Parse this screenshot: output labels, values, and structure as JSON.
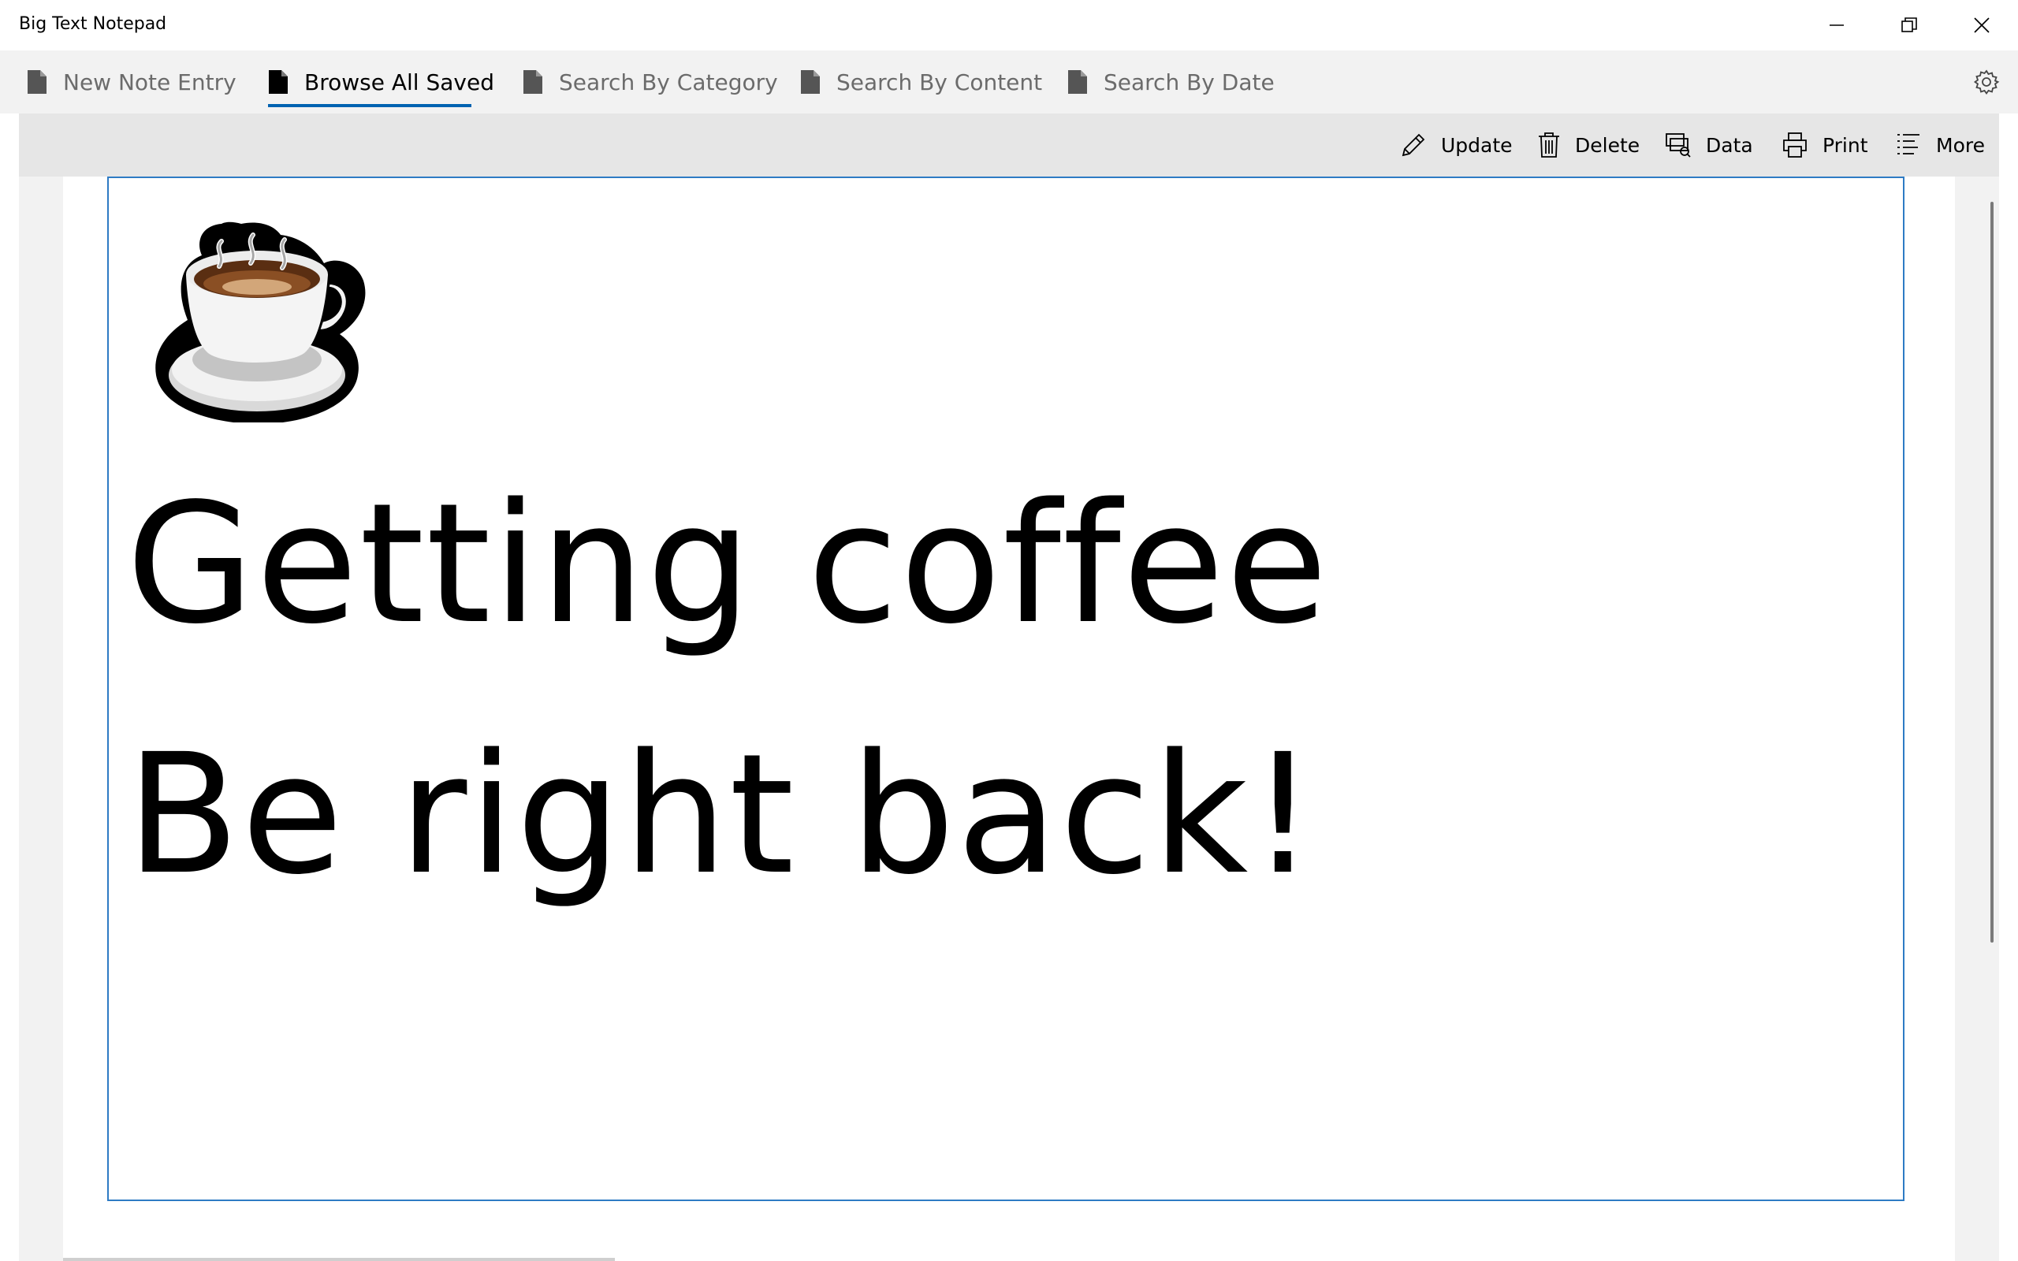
{
  "window": {
    "title": "Big Text Notepad",
    "controls": [
      "minimize",
      "restore",
      "close"
    ]
  },
  "tabs": [
    {
      "label": "New Note Entry",
      "icon": "document-icon",
      "active": false
    },
    {
      "label": "Browse All Saved",
      "icon": "document-icon",
      "active": true
    },
    {
      "label": "Search By Category",
      "icon": "document-icon",
      "active": false
    },
    {
      "label": "Search By Content",
      "icon": "document-icon",
      "active": false
    },
    {
      "label": "Search By Date",
      "icon": "document-icon",
      "active": false
    }
  ],
  "settings": {
    "icon": "gear-icon"
  },
  "commands": [
    {
      "label": "Update",
      "icon": "pencil-icon"
    },
    {
      "label": "Delete",
      "icon": "trash-icon"
    },
    {
      "label": "Data",
      "icon": "data-icon"
    },
    {
      "label": "Print",
      "icon": "printer-icon"
    },
    {
      "label": "More",
      "icon": "list-icon"
    }
  ],
  "note": {
    "emoji": "hot-beverage-icon",
    "line1": "Getting coffee",
    "line2": "Be right back!"
  },
  "colors": {
    "accent": "#0063b1",
    "note_border": "#2e7bc4",
    "tabbar_bg": "#f2f2f2",
    "cmdbar_bg": "#e6e6e6"
  }
}
